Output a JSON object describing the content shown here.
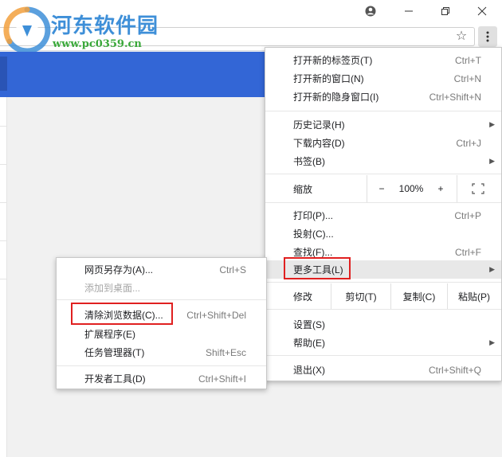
{
  "window": {
    "controls": {
      "minimize": "—",
      "maximize": "❐",
      "close": "✕",
      "account": "●"
    }
  },
  "watermark": {
    "title": "河东软件园",
    "url": "www.pc0359.cn"
  },
  "toolbar": {
    "star": "☆",
    "menu": "⋮"
  },
  "main_menu": {
    "items": [
      {
        "label": "打开新的标签页(T)",
        "shortcut": "Ctrl+T"
      },
      {
        "label": "打开新的窗口(N)",
        "shortcut": "Ctrl+N"
      },
      {
        "label": "打开新的隐身窗口(I)",
        "shortcut": "Ctrl+Shift+N"
      },
      {
        "label": "历史记录(H)",
        "arrow": "▶"
      },
      {
        "label": "下载内容(D)",
        "shortcut": "Ctrl+J"
      },
      {
        "label": "书签(B)",
        "arrow": "▶"
      },
      {
        "label": "打印(P)...",
        "shortcut": "Ctrl+P"
      },
      {
        "label": "投射(C)..."
      },
      {
        "label": "查找(F)...",
        "shortcut": "Ctrl+F"
      },
      {
        "label": "更多工具(L)",
        "arrow": "▶"
      },
      {
        "label": "设置(S)"
      },
      {
        "label": "帮助(E)",
        "arrow": "▶"
      },
      {
        "label": "退出(X)",
        "shortcut": "Ctrl+Shift+Q"
      }
    ],
    "zoom": {
      "label": "缩放",
      "minus": "−",
      "value": "100%",
      "plus": "+",
      "fullscreen": "⛶"
    },
    "edit": {
      "label": "修改",
      "cut": "剪切(T)",
      "copy": "复制(C)",
      "paste": "粘贴(P)"
    }
  },
  "submenu": {
    "items": [
      {
        "label": "网页另存为(A)...",
        "shortcut": "Ctrl+S"
      },
      {
        "label": "添加到桌面...",
        "disabled": true
      },
      {
        "label": "清除浏览数据(C)...",
        "shortcut": "Ctrl+Shift+Del"
      },
      {
        "label": "扩展程序(E)"
      },
      {
        "label": "任务管理器(T)",
        "shortcut": "Shift+Esc"
      },
      {
        "label": "开发者工具(D)",
        "shortcut": "Ctrl+Shift+I"
      }
    ]
  },
  "colors": {
    "accent": "#3366d6",
    "highlight_box": "#e02020"
  }
}
